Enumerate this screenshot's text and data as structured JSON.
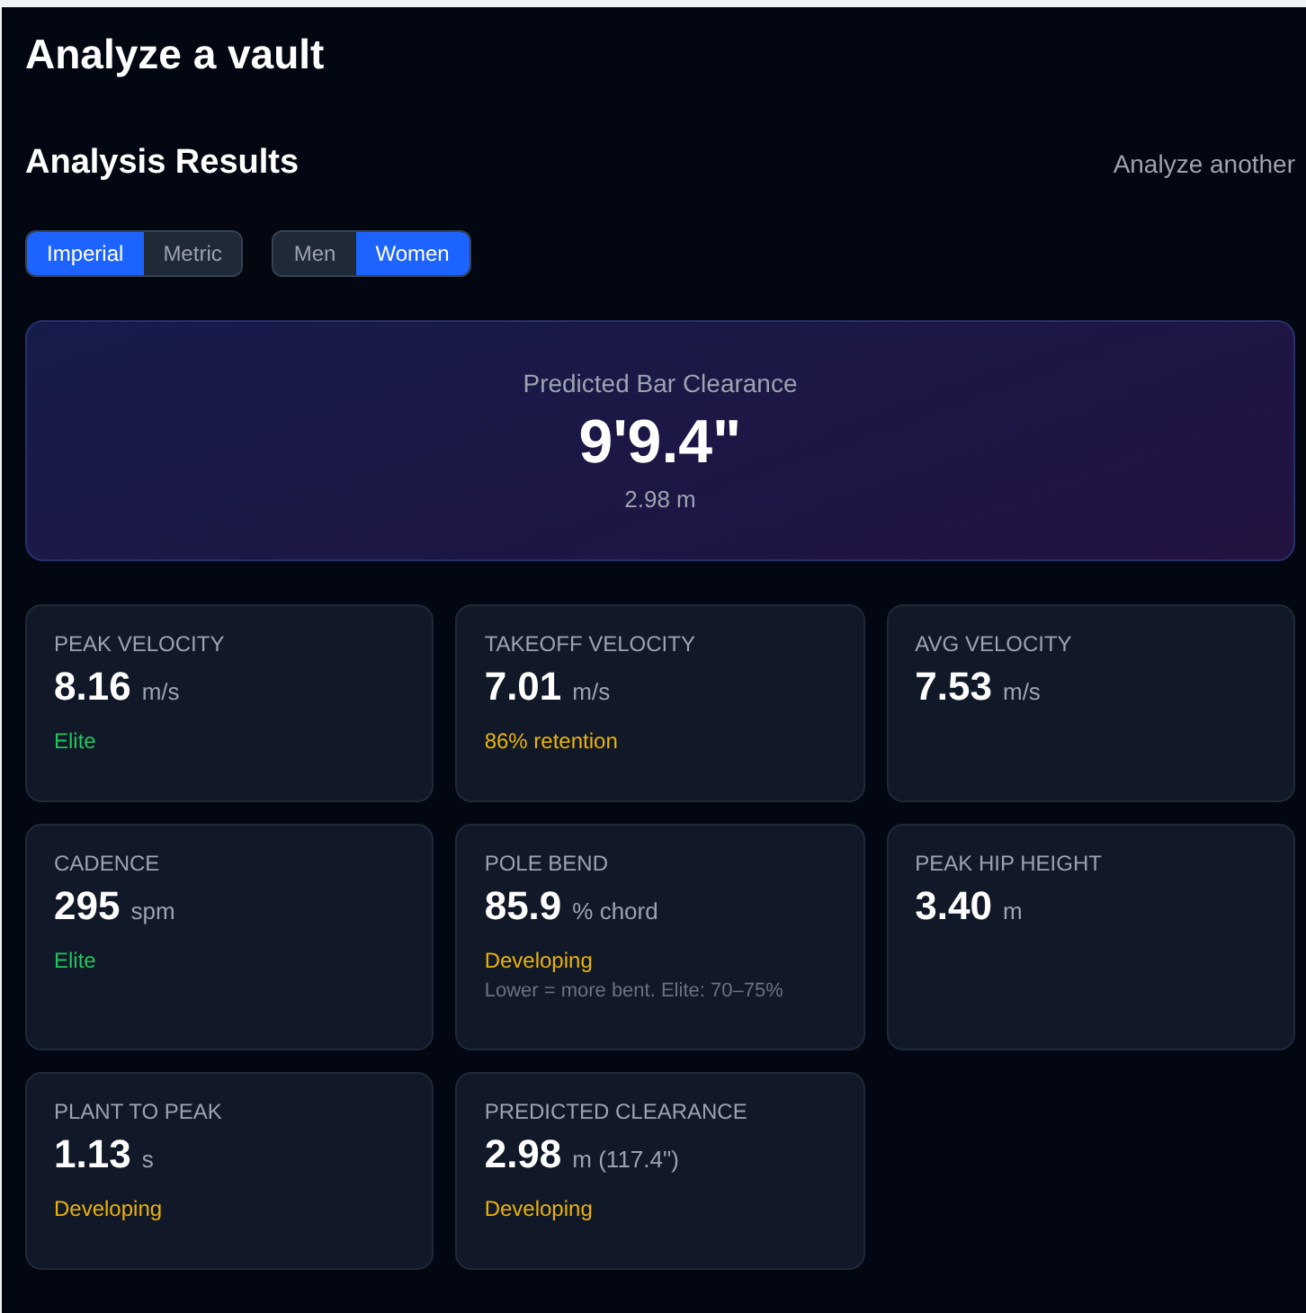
{
  "page_title": "Analyze a vault",
  "section": {
    "title": "Analysis Results",
    "action": "Analyze another"
  },
  "toggles": [
    {
      "options": [
        {
          "label": "Imperial",
          "selected": true
        },
        {
          "label": "Metric",
          "selected": false
        }
      ]
    },
    {
      "options": [
        {
          "label": "Men",
          "selected": false
        },
        {
          "label": "Women",
          "selected": true
        }
      ]
    }
  ],
  "hero": {
    "label": "Predicted Bar Clearance",
    "value": "9'9.4\"",
    "sub": "2.98 m"
  },
  "metrics": [
    {
      "label": "PEAK VELOCITY",
      "value": "8.16",
      "unit": "m/s",
      "status": {
        "text": "Elite",
        "color": "#22c55e"
      }
    },
    {
      "label": "TAKEOFF VELOCITY",
      "value": "7.01",
      "unit": "m/s",
      "status": {
        "text": "86% retention",
        "color": "#eab308"
      }
    },
    {
      "label": "AVG VELOCITY",
      "value": "7.53",
      "unit": "m/s"
    },
    {
      "label": "CADENCE",
      "value": "295",
      "unit": "spm",
      "status": {
        "text": "Elite",
        "color": "#22c55e"
      }
    },
    {
      "label": "POLE BEND",
      "value": "85.9",
      "unit": "% chord",
      "status": {
        "text": "Developing",
        "color": "#eab308"
      },
      "note": "Lower = more bent. Elite: 70–75%"
    },
    {
      "label": "PEAK HIP HEIGHT",
      "value": "3.40",
      "unit": "m"
    },
    {
      "label": "PLANT TO PEAK",
      "value": "1.13",
      "unit": "s",
      "status": {
        "text": "Developing",
        "color": "#eab308"
      }
    },
    {
      "label": "PREDICTED CLEARANCE",
      "value": "2.98",
      "unit": "m (117.4\")",
      "status": {
        "text": "Developing",
        "color": "#eab308"
      }
    }
  ]
}
